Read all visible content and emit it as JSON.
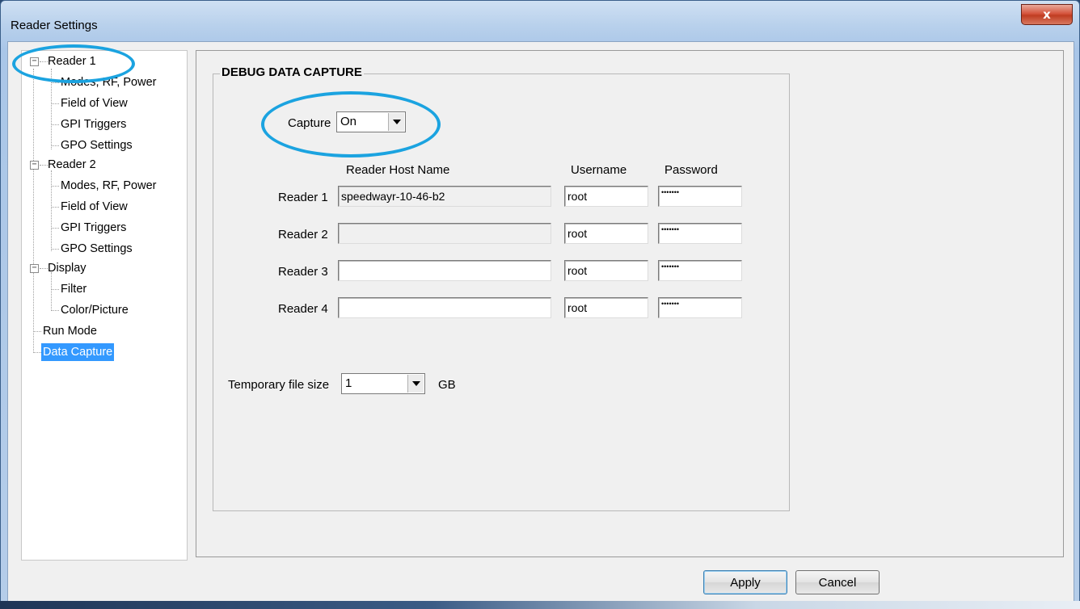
{
  "window": {
    "title": "Reader Settings",
    "close_glyph": "x"
  },
  "tree": {
    "items": [
      {
        "label": "Reader 1",
        "expanded": "⊟"
      },
      {
        "label": "Modes, RF, Power"
      },
      {
        "label": "Field of View"
      },
      {
        "label": "GPI Triggers"
      },
      {
        "label": "GPO Settings"
      },
      {
        "label": "Reader 2",
        "expanded": "⊟"
      },
      {
        "label": "Modes, RF, Power"
      },
      {
        "label": "Field of View"
      },
      {
        "label": "GPI Triggers"
      },
      {
        "label": "GPO Settings"
      },
      {
        "label": "Display",
        "expanded": "⊟"
      },
      {
        "label": "Filter"
      },
      {
        "label": "Color/Picture"
      },
      {
        "label": "Run Mode"
      },
      {
        "label": "Data Capture",
        "selected": true
      }
    ],
    "expander_glyph": "−"
  },
  "group": {
    "title": "DEBUG DATA CAPTURE",
    "capture_label": "Capture",
    "capture_value": "On",
    "col_host": "Reader Host Name",
    "col_user": "Username",
    "col_pass": "Password",
    "readers": [
      {
        "label": "Reader 1",
        "host": "speedwayr-10-46-b2",
        "user": "root",
        "password": "•••••••"
      },
      {
        "label": "Reader 2",
        "host": "",
        "user": "root",
        "password": "•••••••"
      },
      {
        "label": "Reader 3",
        "host": "",
        "user": "root",
        "password": "•••••••"
      },
      {
        "label": "Reader 4",
        "host": "",
        "user": "root",
        "password": "•••••••"
      }
    ],
    "tempsize_label": "Temporary file size",
    "tempsize_value": "1",
    "tempsize_unit": "GB"
  },
  "buttons": {
    "apply": "Apply",
    "cancel": "Cancel"
  },
  "colors": {
    "selection": "#3399ff",
    "annotation_circle": "#1ba3e0"
  }
}
